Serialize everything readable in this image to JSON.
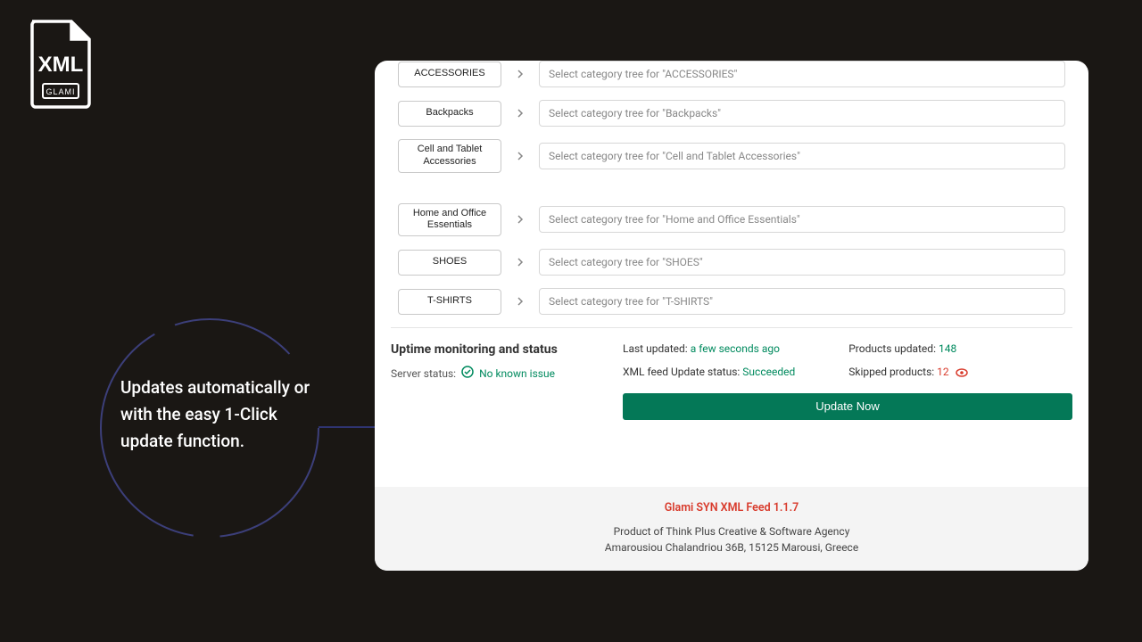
{
  "logo": {
    "text": "XML",
    "sublabel": "GLAMI"
  },
  "callout": "Updates automatically or with the easy 1-Click update function.",
  "categories": [
    {
      "label": "ACCESSORIES",
      "placeholder": "Select category tree for \"ACCESSORIES\""
    },
    {
      "label": "Backpacks",
      "placeholder": "Select category tree for \"Backpacks\""
    },
    {
      "label": "Cell and Tablet Accessories",
      "placeholder": "Select category tree for \"Cell and Tablet Accessories\""
    },
    {
      "label": "Home and Office Essentials",
      "placeholder": "Select category tree for \"Home and Office Essentials\""
    },
    {
      "label": "SHOES",
      "placeholder": "Select category tree for \"SHOES\""
    },
    {
      "label": "T-SHIRTS",
      "placeholder": "Select category tree for \"T-SHIRTS\""
    }
  ],
  "status": {
    "heading": "Uptime monitoring and status",
    "server_label": "Server status:",
    "server_value": "No known issue",
    "last_updated_label": "Last updated:",
    "last_updated_value": "a few seconds ago",
    "feed_label": "XML feed Update status:",
    "feed_value": "Succeeded",
    "products_label": "Products updated:",
    "products_value": "148",
    "skipped_label": "Skipped products:",
    "skipped_value": "12",
    "update_button": "Update Now"
  },
  "footer": {
    "brand": "Glami SYN XML Feed 1.1.7",
    "line1": "Product of Think Plus Creative & Software Agency",
    "line2": "Amarousiou Chalandriou 36B, 15125 Marousi, Greece"
  }
}
